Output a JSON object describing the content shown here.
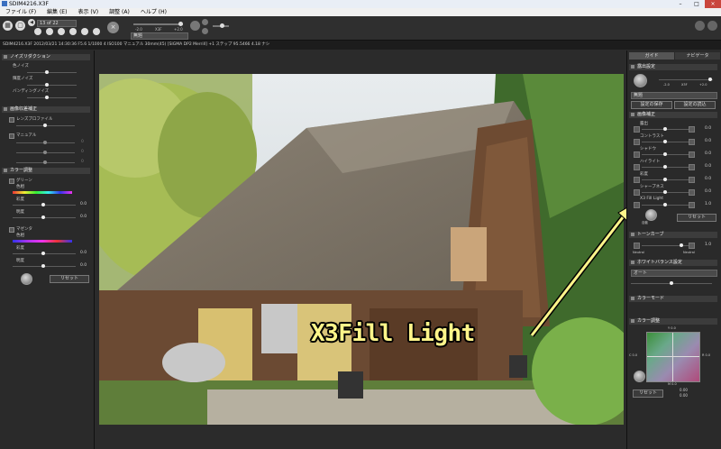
{
  "window": {
    "title": "SDIM4216.X3F",
    "controls": {
      "minimize": "–",
      "maximize": "□",
      "close": "×"
    }
  },
  "menu": [
    "ファイル (F)",
    "編集 (E)",
    "表示 (V)",
    "調整 (A)",
    "ヘルプ (H)"
  ],
  "toolbar": {
    "counter": "13 of 22",
    "preset": "無題",
    "exposure_marks": [
      "-2.0",
      "X3F",
      "+2.0"
    ]
  },
  "info": "SDIM4216.X3F 2012/03/21 14:30:36 F5.6 1/1000 4 ISO100 マニュアル 30mm(45) [SIGMA DP2 Merrill] +1 ステップ 95.5466 4.18 ナシ",
  "left_panel": {
    "noise_title": "ノイズリダクション",
    "noise_items": [
      "色ノイズ",
      "輝度ノイズ",
      "バンディングノイズ"
    ],
    "lens_title": "画像収差補正",
    "lens_items": [
      "レンズプロファイル",
      "マニュアル"
    ],
    "lens_dim_values": [
      "0",
      "0",
      "0"
    ],
    "color_title": "カラー調整",
    "color_items": [
      "グリーン",
      "色相",
      "彩度",
      "明度",
      "マゼンタ",
      "色相",
      "彩度",
      "明度"
    ],
    "color_values": [
      "0.0",
      "0.0",
      "0.0",
      "0.0"
    ],
    "reset_label": "リセット"
  },
  "right_panel": {
    "tabs": [
      "ガイド",
      "ナビゲータ"
    ],
    "exposure_title": "露出設定",
    "exposure_marks": [
      "-2.0",
      "X3F",
      "+2.0"
    ],
    "preset": "無題",
    "save_label": "設定の保存",
    "load_label": "設定の読込",
    "image_title": "画像補正",
    "image_items": [
      "露出",
      "コントラスト",
      "シャドウ",
      "ハイライト",
      "彩度",
      "シャープネス",
      "X3 Fill Light"
    ],
    "image_values": [
      "0.0",
      "0.0",
      "0.0",
      "0.0",
      "0.0",
      "0.0",
      "1.0"
    ],
    "auto_label": "自動",
    "reset_label": "リセット",
    "tone_title": "トーンカーブ",
    "tone_low": "Neutral",
    "tone_high": "Neutral",
    "tone_value": "1.0",
    "wb_title": "ホワイトバランス設定",
    "wb_value": "オート",
    "color_mode_title": "カラーモード",
    "color_adjust_title": "カラー調整",
    "color_grid_top": "Y 0.0",
    "color_grid_bottom": "M 0.0",
    "color_grid_left": "C 0.0",
    "color_grid_right": "R 0.0",
    "color_value1": "0.00",
    "color_value2": "0.00",
    "color_reset": "リセット"
  },
  "callout": "X3Fill Light",
  "colors": {
    "accent_callout": "#fff58a",
    "arrow": "#fff58a"
  }
}
